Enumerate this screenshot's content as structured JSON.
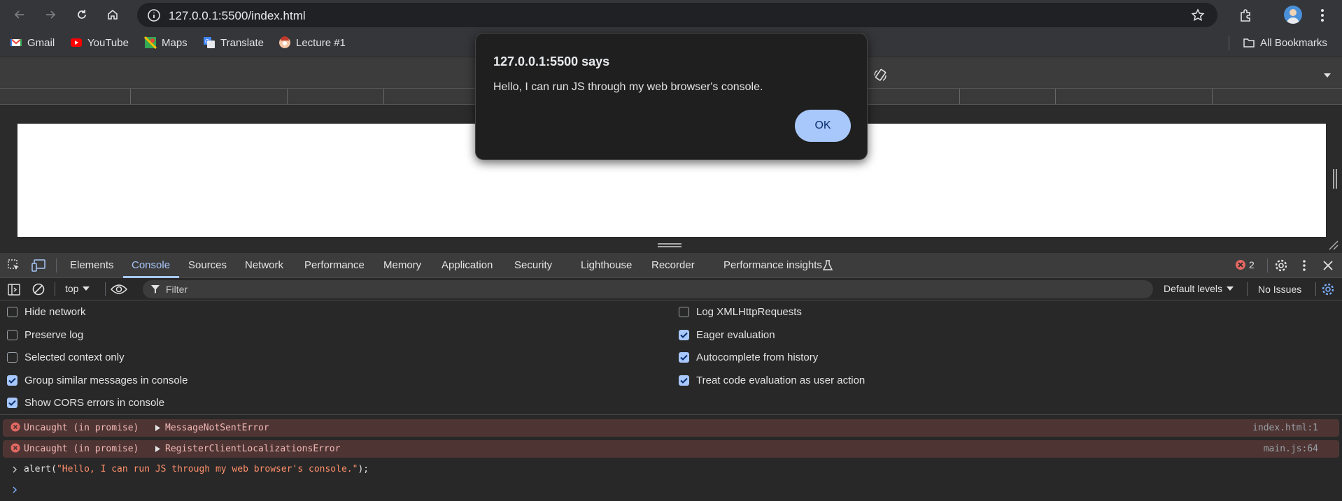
{
  "browser": {
    "url": "127.0.0.1:5500/index.html",
    "bookmarks": [
      "Gmail",
      "YouTube",
      "Maps",
      "Translate",
      "Lecture #1"
    ],
    "all_bookmarks_label": "All Bookmarks"
  },
  "dialog": {
    "title": "127.0.0.1:5500 says",
    "message": "Hello, I can run JS through my web browser's console.",
    "ok_label": "OK"
  },
  "devtools": {
    "tabs": [
      "Elements",
      "Console",
      "Sources",
      "Network",
      "Performance",
      "Memory",
      "Application",
      "Security",
      "Lighthouse",
      "Recorder",
      "Performance insights"
    ],
    "active_tab": "Console",
    "error_count": "2",
    "context": "top",
    "filter_placeholder": "Filter",
    "levels_label": "Default levels",
    "issues_label": "No Issues",
    "settings_left": [
      {
        "label": "Hide network",
        "checked": false
      },
      {
        "label": "Preserve log",
        "checked": false
      },
      {
        "label": "Selected context only",
        "checked": false
      },
      {
        "label": "Group similar messages in console",
        "checked": true
      },
      {
        "label": "Show CORS errors in console",
        "checked": true
      }
    ],
    "settings_right": [
      {
        "label": "Log XMLHttpRequests",
        "checked": false
      },
      {
        "label": "Eager evaluation",
        "checked": true
      },
      {
        "label": "Autocomplete from history",
        "checked": true
      },
      {
        "label": "Treat code evaluation as user action",
        "checked": true
      }
    ],
    "errors": [
      {
        "prefix": "Uncaught (in promise)",
        "name": "MessageNotSentError",
        "source": "index.html:1"
      },
      {
        "prefix": "Uncaught (in promise)",
        "name": "RegisterClientLocalizationsError",
        "source": "main.js:64"
      }
    ],
    "command": {
      "func": "alert(",
      "arg": "\"Hello, I can run JS through my web browser's console.\"",
      "close": ");"
    }
  }
}
